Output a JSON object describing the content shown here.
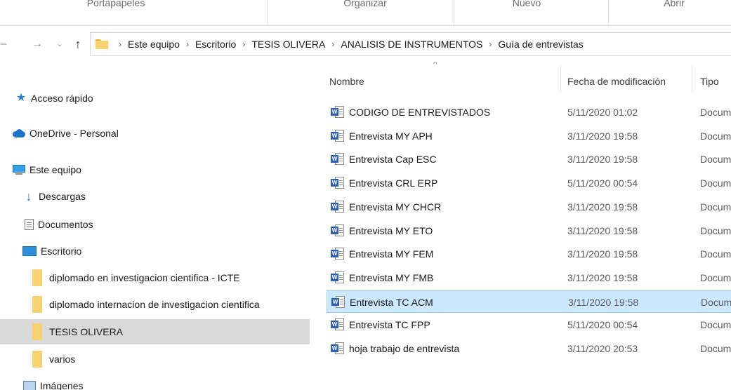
{
  "ribbon": {
    "groups": [
      "Portapapeles",
      "Organizar",
      "Nuevo",
      "Abrir"
    ]
  },
  "navigation": {
    "back_icon": "back-arrow-icon",
    "forward_icon": "forward-arrow-icon",
    "recent_icon": "chevron-down-icon",
    "up_icon": "up-arrow-icon"
  },
  "breadcrumb": [
    "Este equipo",
    "Escritorio",
    "TESIS OLIVERA",
    "ANALISIS DE INSTRUMENTOS",
    "Guía de entrevistas"
  ],
  "sidebar": {
    "items": [
      {
        "label": "Acceso rápido",
        "icon": "star-icon"
      },
      {
        "label": "OneDrive - Personal",
        "icon": "cloud-icon"
      },
      {
        "label": "Este equipo",
        "icon": "computer-icon"
      },
      {
        "label": "Descargas",
        "icon": "download-icon"
      },
      {
        "label": "Documentos",
        "icon": "document-icon"
      },
      {
        "label": "Escritorio",
        "icon": "desktop-icon"
      },
      {
        "label": "diplomado en investigacion cientifica - ICTE",
        "icon": "folder-icon"
      },
      {
        "label": "diplomado internacion de investigacion cientifica",
        "icon": "folder-icon"
      },
      {
        "label": "TESIS OLIVERA",
        "icon": "folder-icon",
        "selected": true
      },
      {
        "label": "varios",
        "icon": "folder-icon"
      },
      {
        "label": "Imágenes",
        "icon": "pictures-icon"
      }
    ]
  },
  "file_list": {
    "columns": [
      "Nombre",
      "Fecha de modificación",
      "Tipo"
    ],
    "rows": [
      {
        "name": "CODIGO DE ENTREVISTADOS",
        "date": "5/11/2020 01:02",
        "type": "Docum"
      },
      {
        "name": "Entrevista  MY APH",
        "date": "3/11/2020 19:58",
        "type": "Docum"
      },
      {
        "name": "Entrevista Cap ESC",
        "date": "3/11/2020 19:58",
        "type": "Docum"
      },
      {
        "name": "Entrevista CRL ERP",
        "date": "5/11/2020 00:54",
        "type": "Docum"
      },
      {
        "name": "Entrevista MY CHCR",
        "date": "3/11/2020 19:58",
        "type": "Docum"
      },
      {
        "name": "Entrevista MY ETO",
        "date": "3/11/2020 19:58",
        "type": "Docum"
      },
      {
        "name": "Entrevista MY FEM",
        "date": "3/11/2020 19:58",
        "type": "Docum"
      },
      {
        "name": "Entrevista MY FMB",
        "date": "3/11/2020 19:58",
        "type": "Docum"
      },
      {
        "name": "Entrevista TC ACM",
        "date": "3/11/2020 19:58",
        "type": "Docum",
        "selected": true
      },
      {
        "name": "Entrevista TC FPP",
        "date": "5/11/2020 00:54",
        "type": "Docum"
      },
      {
        "name": "hoja trabajo de entrevista",
        "date": "3/11/2020 20:53",
        "type": "Docum"
      }
    ],
    "file_icon": "word-document-icon",
    "word_badge": "W"
  },
  "colors": {
    "selected_row": "#cce8ff",
    "selected_nav": "#dadada",
    "folder": "#f8d270",
    "word_blue": "#2b5fb4"
  }
}
